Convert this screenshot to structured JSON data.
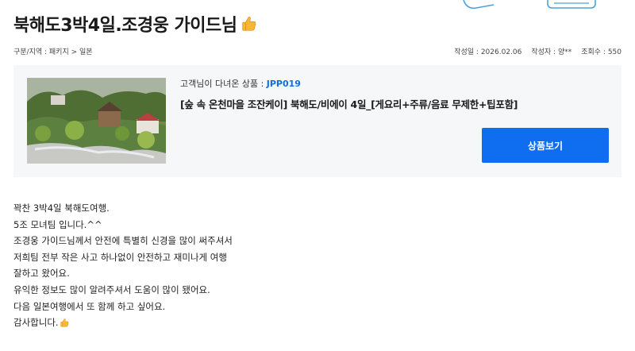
{
  "post": {
    "title": "북해도3박4일.조경웅 가이드님",
    "category": "구분/지역 : 패키지 > 일본",
    "date_label": "작성일 : 2026.02.06",
    "author_label": "작성자 : 양**",
    "views_label": "조회수 : 550"
  },
  "product": {
    "reviewed_prefix": "고객님이 다녀온 상품 : ",
    "code": "JPP019",
    "name": "[숲 속 온천마을 조잔케이] 북해도/비에이 4일_[게요리+주류/음료 무제한+팁포함]",
    "button_label": "상품보기"
  },
  "content": {
    "lines": [
      " 꽉찬 3박4일 북해도여행.",
      "5조 모녀팀 입니다.^^",
      "조경웅 가이드님께서 안전에 특별히 신경을 많이 써주셔서",
      "저희팀 전부 작은 사고 하나없이 안전하고 재미나게 여행",
      "잘하고 왔어요.",
      "유익한 정보도 많이 알려주셔서 도움이 많이 됐어요.",
      "다음 일본여행에서 또 함께 하고 싶어요.",
      "감사합니다."
    ]
  },
  "colors": {
    "accent": "#0f6ef0",
    "code_color": "#0d6fe8",
    "card_bg": "#f6f7f9"
  },
  "icons": {
    "title_emoji": "thumbs-up-icon",
    "closing_emoji": "thumbs-up-icon"
  }
}
